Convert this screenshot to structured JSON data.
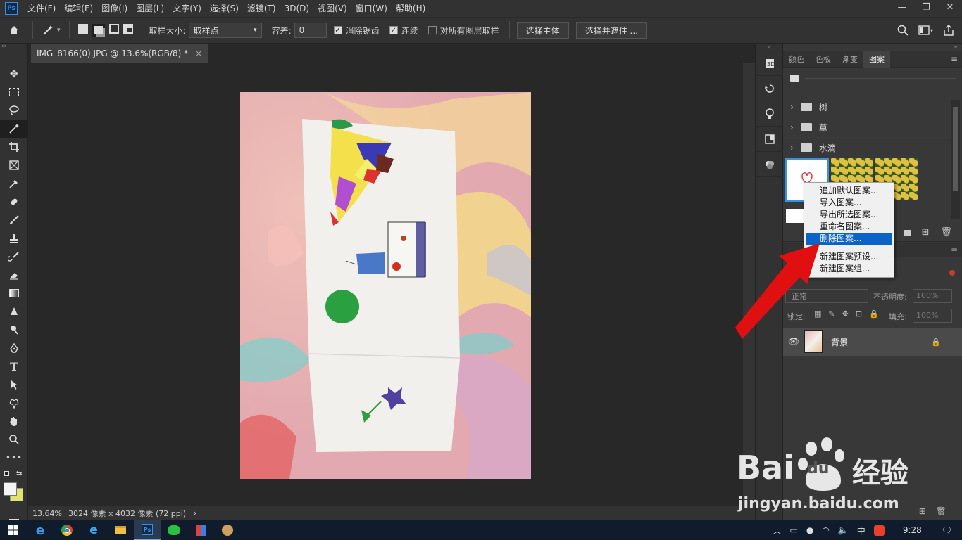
{
  "menubar": {
    "items": [
      "文件(F)",
      "编辑(E)",
      "图像(I)",
      "图层(L)",
      "文字(Y)",
      "选择(S)",
      "滤镜(T)",
      "3D(D)",
      "视图(V)",
      "窗口(W)",
      "帮助(H)"
    ],
    "window_controls": [
      "—",
      "❐",
      "✕"
    ]
  },
  "options": {
    "sample_size_label": "取样大小:",
    "sample_size_value": "取样点",
    "tolerance_label": "容差:",
    "tolerance_value": "0",
    "antialias_label": "消除锯齿",
    "contiguous_label": "连续",
    "all_layers_label": "对所有图层取样",
    "select_subject": "选择主体",
    "select_mask": "选择并遮住 ..."
  },
  "document": {
    "tab_title": "IMG_8166(0).JPG @ 13.6%(RGB/8) *",
    "close_glyph": "×"
  },
  "status": {
    "zoom": "13.64%",
    "dimensions": "3024 像素 x 4032 像素 (72 ppi)",
    "arrow": "›"
  },
  "panel": {
    "tabs": [
      "颜色",
      "色板",
      "渐变",
      "图案"
    ],
    "folders": [
      "树",
      "草",
      "水滴"
    ]
  },
  "context_menu": {
    "items_a": [
      "追加默认图案...",
      "导入图案...",
      "导出所选图案...",
      "重命名图案...",
      "删除图案..."
    ],
    "items_b": [
      "新建图案预设...",
      "新建图案组..."
    ]
  },
  "layers": {
    "blend_mode": "正常",
    "opacity_label": "不透明度:",
    "opacity_value": "100%",
    "lock_label": "锁定:",
    "fill_label": "填充:",
    "fill_value": "100%",
    "layer_name": "背景"
  },
  "watermark": {
    "brand": "Bai",
    "brand_tail": "du",
    "cn": "经验",
    "url": "jingyan.baidu.com"
  },
  "taskbar": {
    "time": "9:28",
    "ime": "中"
  },
  "colors": {
    "accent": "#0a64c8",
    "arrow_red": "#e01010"
  }
}
